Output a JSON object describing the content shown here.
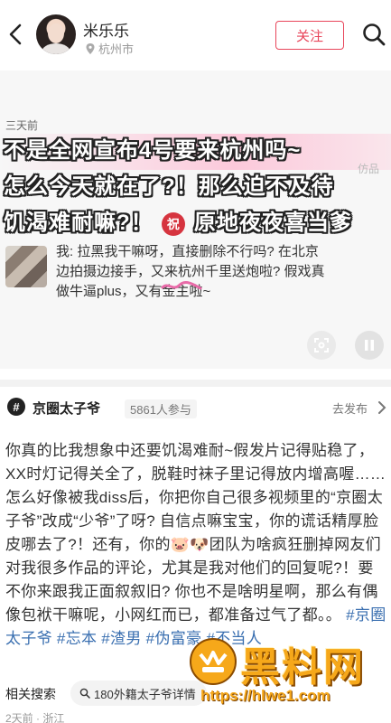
{
  "header": {
    "username": "米乐乐",
    "location": "杭州市",
    "follow_label": "关注"
  },
  "feed": {
    "time_label": "三天前",
    "overlay_lines": [
      "不是全网宣布4号要来杭州吗~",
      "怎么今天就在了?！那么迫不及待",
      "饥渴难耐嘛?！",
      "原地夜夜喜当爹"
    ],
    "blessing_char": "祝",
    "hidden_partial": "仿品",
    "reply_text": "我: 拉黑我干嘛呀，直接删除不行吗? 在北京边拍摄边接手，又来杭州千里送炮啦? 假戏真做牛逼plus，又有金主啦~"
  },
  "topic": {
    "name": "京圈太子爷",
    "count": "5861人参与",
    "go_label": "去发布"
  },
  "post": {
    "text": "你真的比我想象中还要饥渴难耐~假发片记得贴稳了，XX时灯记得关全了，脱鞋时袜子里记得放内增高喔……怎么好像被我diss后，你把你自己很多视频里的“京圈太子爷”改成“少爷”了呀? 自信点嘛宝宝，你的谎话精厚脸皮哪去了?！还有，你的🐷🐶团队为啥疯狂删掉网友们对我很多作品的评论，尤其是我对他们的回复呢?！要不你来跟我正面叙叙旧? 你也不是啥明星啊，那么有偶像包袱干嘛呢，小网红而已，都准备过气了都。。",
    "tags": "#京圈太子爷 #忘本 #渣男 #伪富豪 #不当人"
  },
  "related": {
    "label": "相关搜索",
    "query": "180外籍太子爷详情"
  },
  "footer": {
    "meta": "2天前 · 浙江"
  },
  "watermark": {
    "title": "黑料网",
    "url": "https://hlwe1.com"
  },
  "colors": {
    "accent": "#e8455a",
    "tag_blue": "#3a6fb0",
    "watermark_gold": "#f6a81a"
  }
}
